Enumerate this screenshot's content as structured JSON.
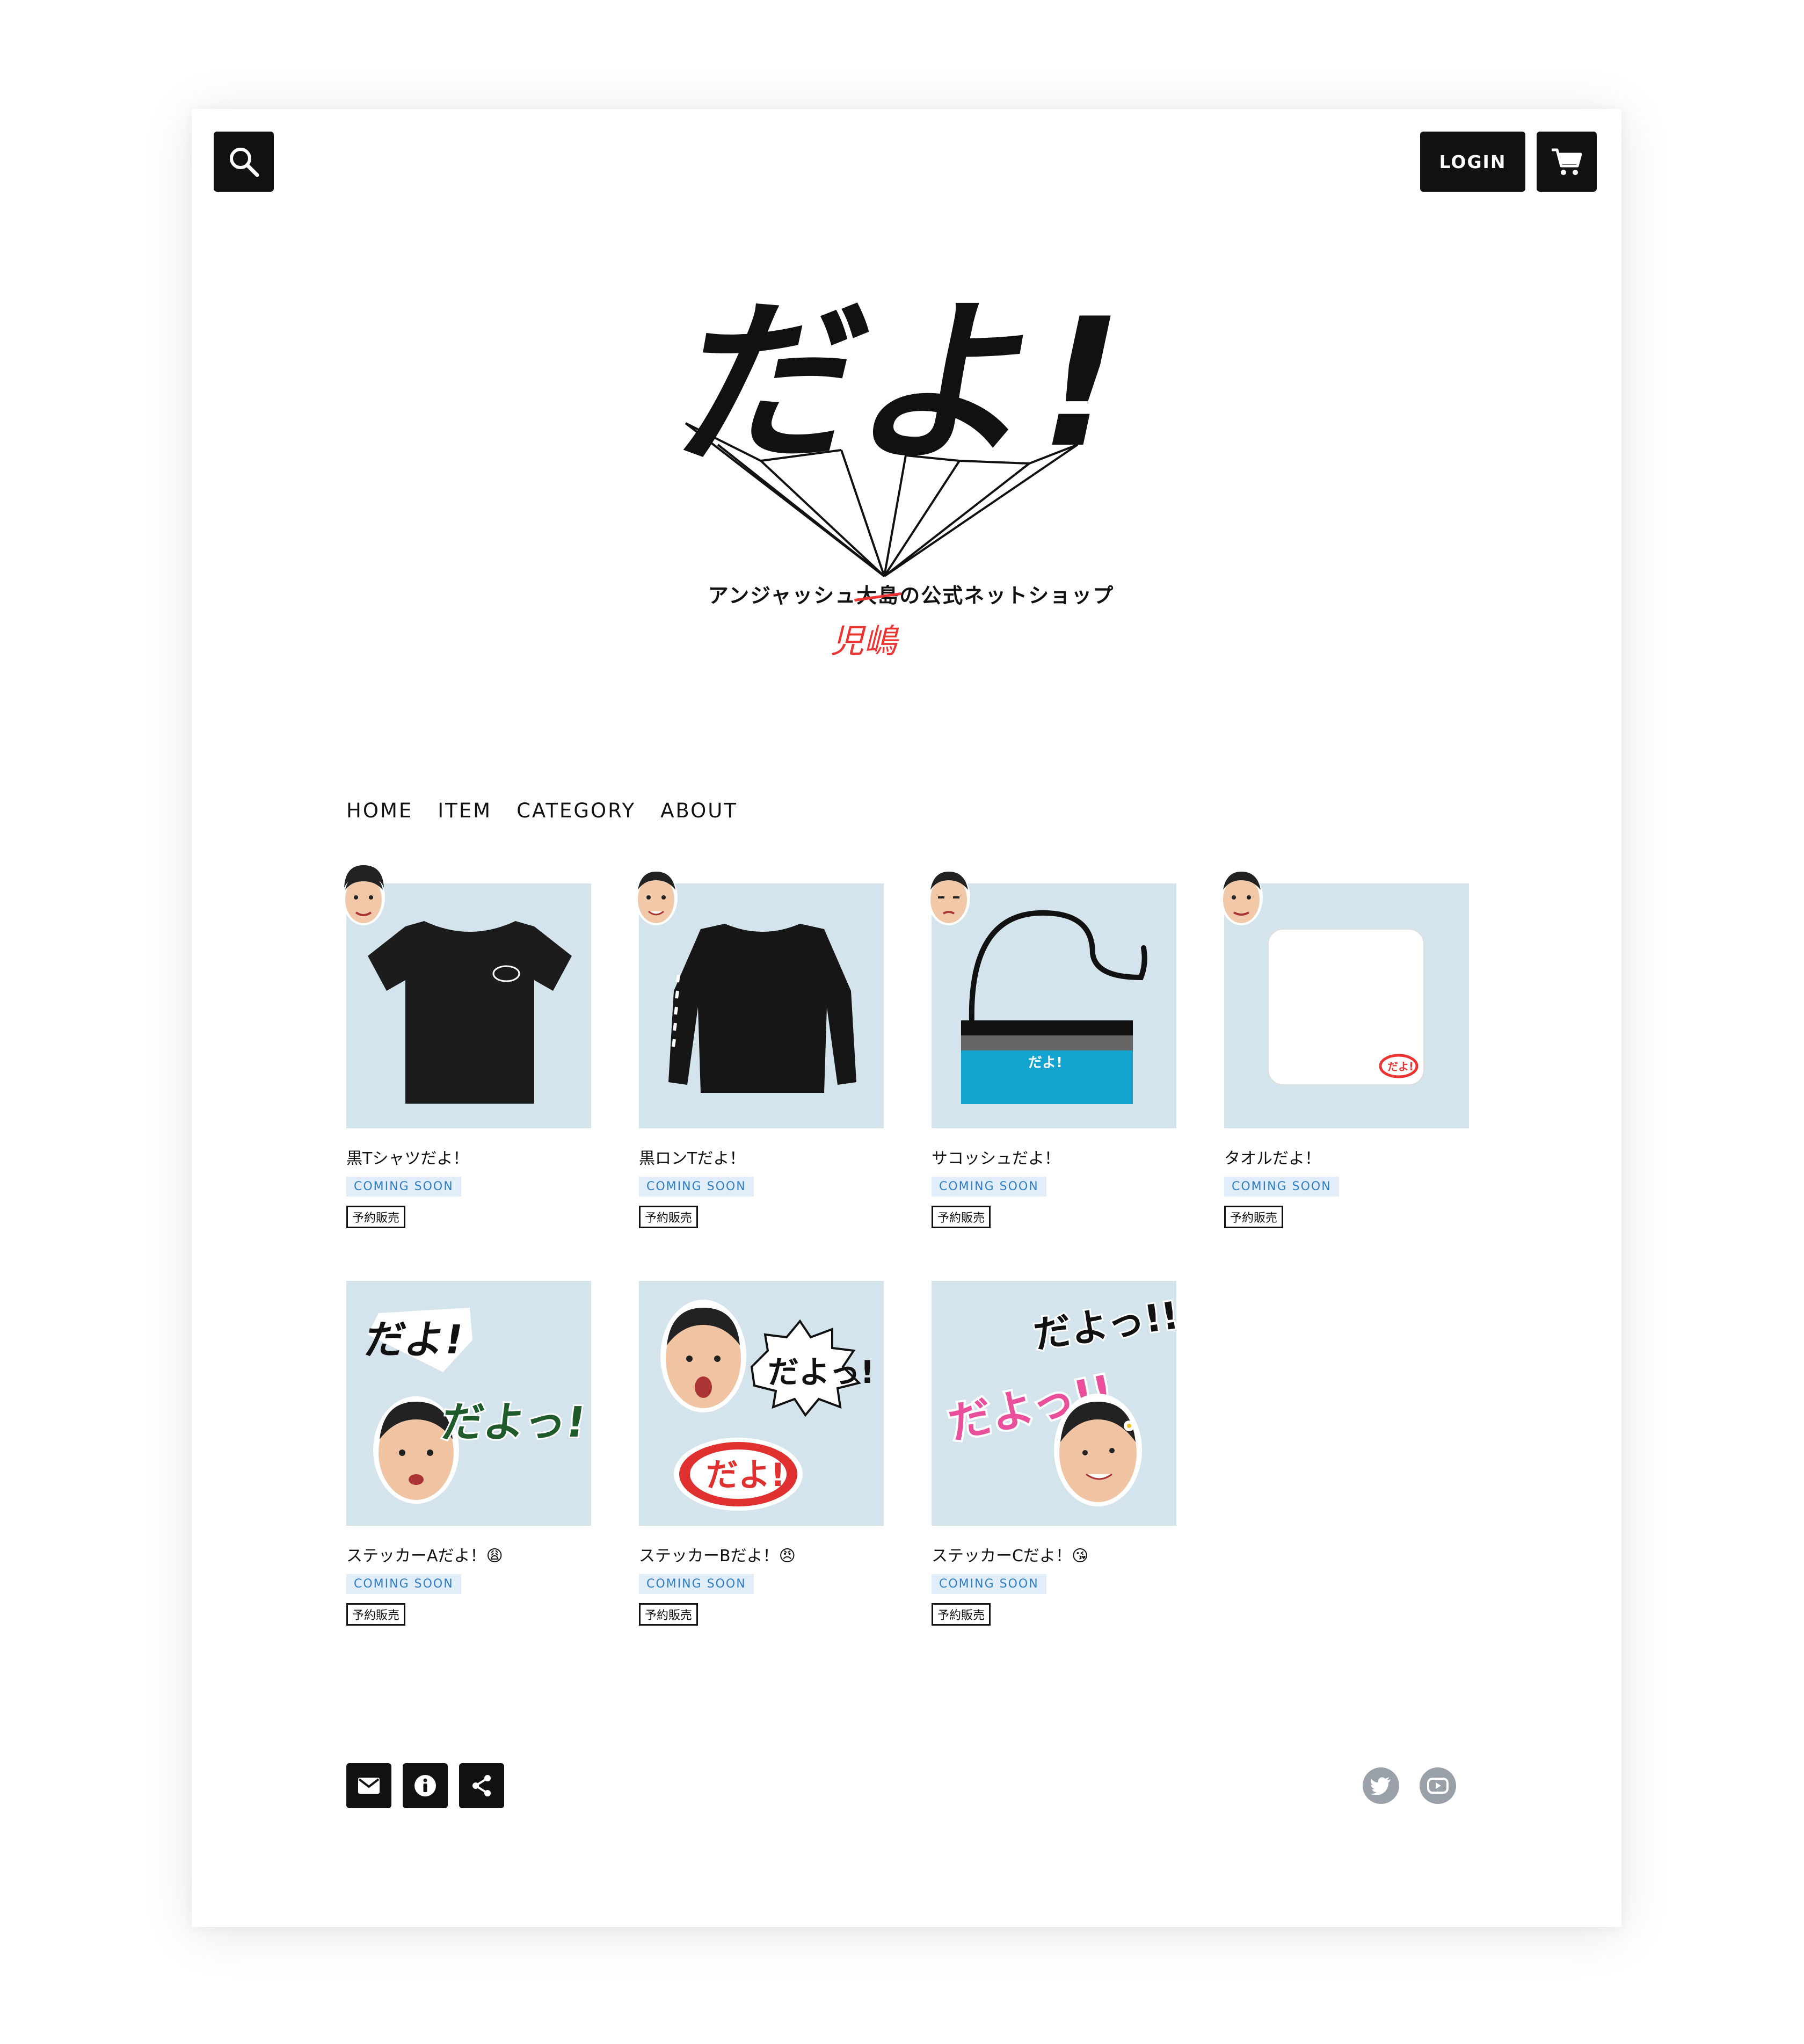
{
  "header": {
    "login_label": "LOGIN",
    "search_icon": "search-icon",
    "cart_icon": "cart-icon"
  },
  "logo": {
    "text": "だよ!",
    "tagline_before": "アンジャッシュ",
    "tagline_struck": "大島",
    "tagline_after": "の公式ネットショップ",
    "correction": "児嶋",
    "correction_color": "#e33333"
  },
  "nav": {
    "items": [
      {
        "label": "HOME"
      },
      {
        "label": "ITEM"
      },
      {
        "label": "CATEGORY"
      },
      {
        "label": "ABOUT"
      }
    ]
  },
  "products": [
    {
      "name": "黒Tシャツだよ！",
      "status": "COMING SOON",
      "tag": "予約販売",
      "image": "black-tshirt"
    },
    {
      "name": "黒ロンTだよ！",
      "status": "COMING SOON",
      "tag": "予約販売",
      "image": "black-longsleeve"
    },
    {
      "name": "サコッシュだよ！",
      "status": "COMING SOON",
      "tag": "予約販売",
      "image": "sacoche-bag"
    },
    {
      "name": "タオルだよ！",
      "status": "COMING SOON",
      "tag": "予約販売",
      "image": "white-towel"
    },
    {
      "name": "ステッカーAだよ！😩",
      "status": "COMING SOON",
      "tag": "予約販売",
      "image": "sticker-a",
      "sticker_words": [
        "だよ!",
        "だよっ!"
      ]
    },
    {
      "name": "ステッカーBだよ！😠",
      "status": "COMING SOON",
      "tag": "予約販売",
      "image": "sticker-b",
      "sticker_words": [
        "だよっ!",
        "だよ!"
      ]
    },
    {
      "name": "ステッカーCだよ！😘",
      "status": "COMING SOON",
      "tag": "予約販売",
      "image": "sticker-c",
      "sticker_words": [
        "だよっ!!",
        "だよっ!!"
      ]
    }
  ],
  "footer": {
    "icons": [
      "mail-icon",
      "info-icon",
      "share-icon"
    ],
    "social": [
      "twitter-icon",
      "youtube-icon"
    ]
  },
  "colors": {
    "accent": "#111111",
    "thumb_bg": "#d3e4ec",
    "soon_bg": "#e1eef9",
    "soon_text": "#2e7dc2",
    "social_grey": "#9aa0a8"
  }
}
